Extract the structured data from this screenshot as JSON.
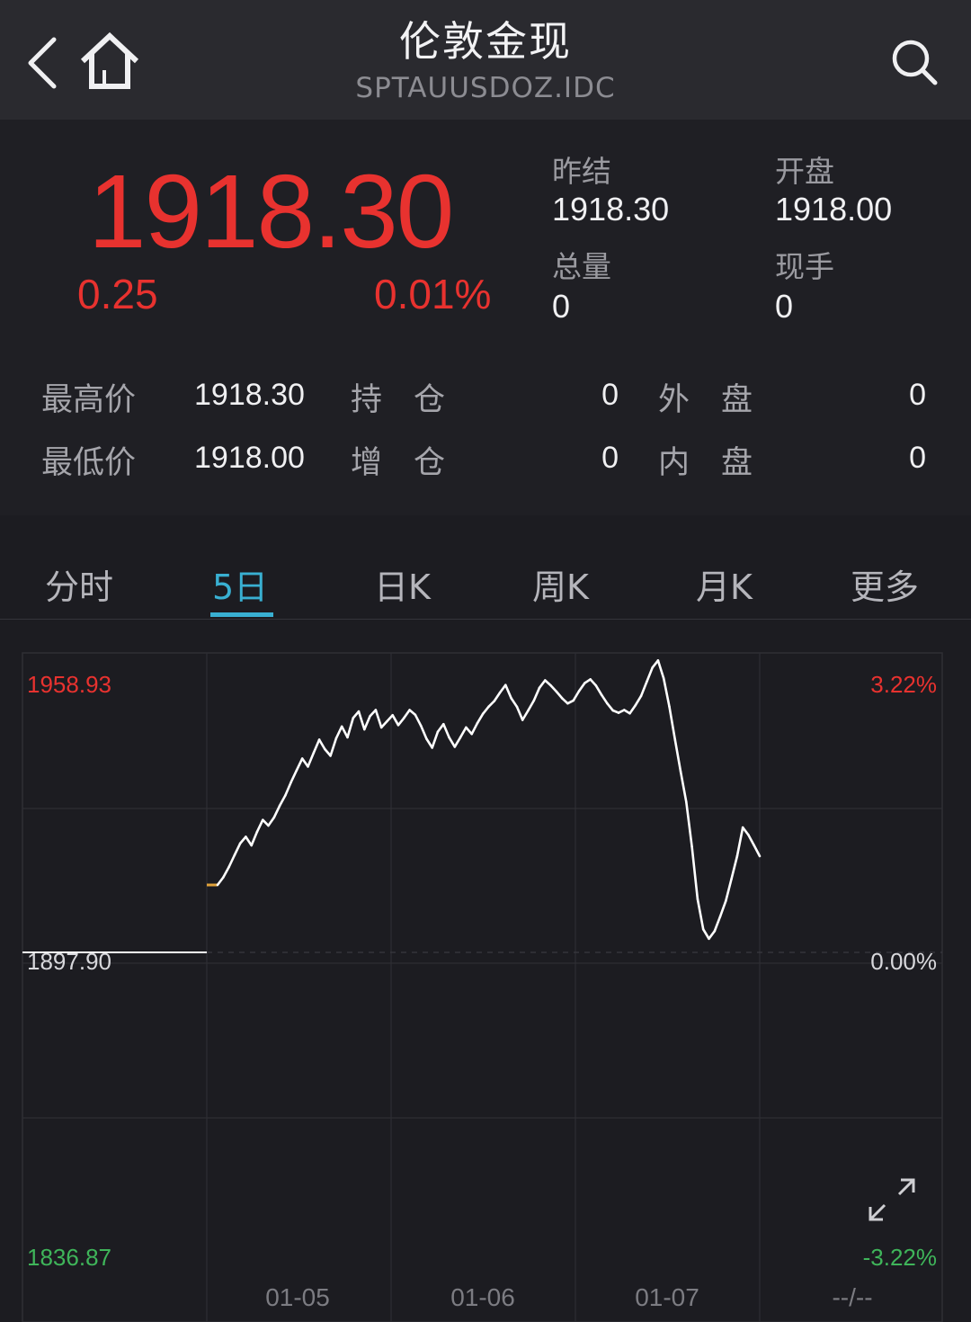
{
  "header": {
    "title": "伦敦金现",
    "subtitle": "SPTAUUSDOZ.IDC",
    "back_icon": "chevron-left-icon",
    "home_icon": "home-icon",
    "search_icon": "search-icon"
  },
  "quote": {
    "price": "1918.30",
    "change": "0.25",
    "change_pct": "0.01%",
    "up_color": "#e8322f",
    "stats": [
      {
        "label": "昨结",
        "value": "1918.30"
      },
      {
        "label": "开盘",
        "value": "1918.00"
      },
      {
        "label": "总量",
        "value": "0"
      },
      {
        "label": "现手",
        "value": "0"
      }
    ],
    "rows": [
      {
        "label": "最高价",
        "value": "1918.30",
        "label2": "持　仓",
        "value2": "0",
        "label3": "外　盘",
        "value3": "0"
      },
      {
        "label": "最低价",
        "value": "1918.00",
        "label2": "增　仓",
        "value2": "0",
        "label3": "内　盘",
        "value3": "0"
      }
    ]
  },
  "tabs": {
    "items": [
      "分时",
      "5日",
      "日K",
      "周K",
      "月K",
      "更多"
    ],
    "active": "5日",
    "accent_color": "#39b0d2"
  },
  "chart_data": {
    "type": "line",
    "series": [
      {
        "values": [
          1912.2,
          1913.8,
          1916.0,
          1918.5,
          1921.0,
          1922.4,
          1920.6,
          1923.5,
          1926.0,
          1924.8,
          1926.5,
          1929.0,
          1931.2,
          1934.0,
          1936.5,
          1939.0,
          1937.3,
          1940.2,
          1943.0,
          1941.0,
          1939.6,
          1943.3,
          1945.8,
          1943.5,
          1947.6,
          1949.0,
          1945.2,
          1948.0,
          1949.3,
          1945.6,
          1946.9,
          1948.2,
          1946.1,
          1947.6,
          1949.3,
          1948.3,
          1946.0,
          1943.2,
          1941.3,
          1944.7,
          1946.3,
          1943.5,
          1941.5,
          1943.5,
          1945.6,
          1944.2,
          1946.5,
          1948.5,
          1950.0,
          1951.2,
          1953.0,
          1954.6,
          1951.8,
          1950.0,
          1947.2,
          1949.2,
          1951.3,
          1954.0,
          1955.6,
          1954.5,
          1953.2,
          1951.8,
          1950.7,
          1951.3,
          1953.3,
          1955.0,
          1955.8,
          1954.5,
          1952.5,
          1950.7,
          1949.2,
          1948.7,
          1949.3,
          1948.6,
          1950.3,
          1952.3,
          1955.3,
          1958.3,
          1959.8,
          1956.0,
          1950.0,
          1943.0,
          1936.2,
          1929.8,
          1920.3,
          1909.2,
          1902.8,
          1900.8,
          1902.4,
          1905.5,
          1908.8,
          1913.5,
          1918.3,
          1924.4,
          1922.8,
          1920.6,
          1918.3
        ]
      }
    ],
    "prev_close": 1897.9,
    "ylim": [
      1836.87,
      1958.93
    ],
    "y_labels_left": [
      "1958.93",
      "1897.90",
      "1836.87"
    ],
    "y_labels_right": [
      "3.22%",
      "0.00%",
      "-3.22%"
    ],
    "x_labels": [
      "01-05",
      "01-06",
      "01-07",
      "--/--"
    ],
    "grid": true,
    "line_color": "#ffffff",
    "up_color": "#e8322f",
    "down_color": "#3fb55a",
    "neutral_color": "#d8d8dc",
    "expand_icon": "expand-arrows-icon"
  }
}
